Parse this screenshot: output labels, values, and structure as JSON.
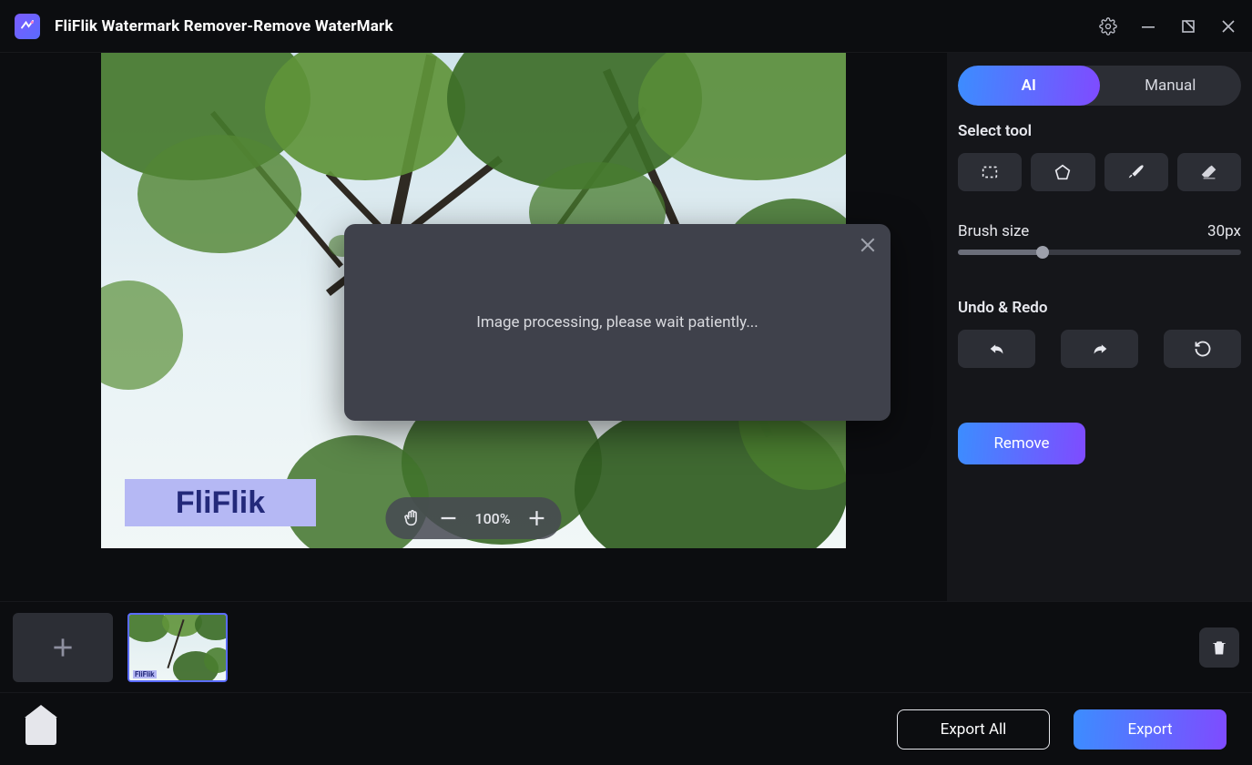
{
  "titlebar": {
    "app_title": "FliFlik Watermark Remover-Remove WaterMark"
  },
  "panel": {
    "mode_ai": "AI",
    "mode_manual": "Manual",
    "select_tool_label": "Select tool",
    "brush_label": "Brush size",
    "brush_value": "30px",
    "undo_label": "Undo & Redo",
    "remove_label": "Remove"
  },
  "zoom": {
    "level": "100%"
  },
  "canvas": {
    "watermark_text": "FliFlik",
    "thumb_text": "FliFlik"
  },
  "modal": {
    "message": "Image processing, please wait patiently..."
  },
  "footer": {
    "export_all": "Export All",
    "export": "Export"
  },
  "colors": {
    "accent_gradient_start": "#3c8dff",
    "accent_gradient_end": "#7f4bff"
  }
}
